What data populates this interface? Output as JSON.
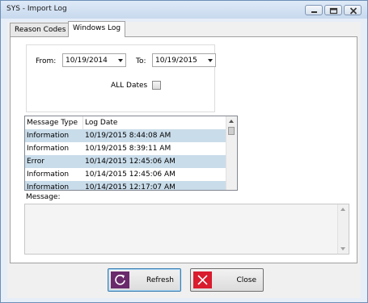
{
  "window": {
    "title": "SYS - Import Log"
  },
  "tabs": [
    {
      "label": "Reason Codes",
      "active": false
    },
    {
      "label": "Windows Log",
      "active": true
    }
  ],
  "filters": {
    "from_label": "From:",
    "from_value": "10/19/2014",
    "to_label": "To:",
    "to_value": "10/19/2015",
    "all_dates_label": "ALL Dates",
    "all_dates_checked": false
  },
  "log_table": {
    "columns": [
      "Message Type",
      "Log Date"
    ],
    "rows": [
      {
        "type": "Information",
        "date": "10/19/2015 8:44:08 AM"
      },
      {
        "type": "Information",
        "date": "10/19/2015 8:39:11 AM"
      },
      {
        "type": "Error",
        "date": "10/14/2015 12:45:06 AM"
      },
      {
        "type": "Information",
        "date": "10/14/2015 12:45:06 AM"
      },
      {
        "type": "Information",
        "date": "10/14/2015 12:17:07 AM"
      }
    ]
  },
  "message": {
    "label": "Message:",
    "value": ""
  },
  "buttons": {
    "refresh_label": "Refresh",
    "close_label": "Close"
  },
  "colors": {
    "row_highlight": "#c9dcea",
    "refresh_icon_bg": "#6a2a6b",
    "close_icon_bg": "#d91c2e"
  },
  "icons": {
    "minimize": "minimize-icon",
    "maximize": "maximize-icon",
    "close": "close-window-icon",
    "refresh": "refresh-icon",
    "close_button": "x-icon"
  }
}
